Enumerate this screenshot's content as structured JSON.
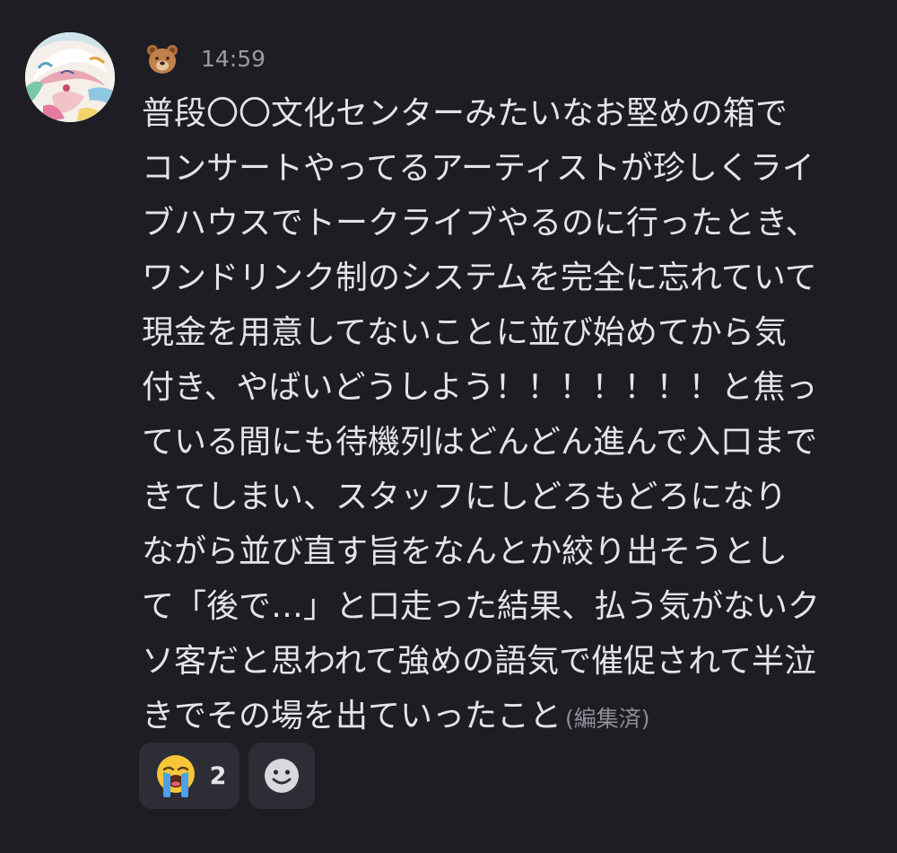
{
  "message": {
    "author_emoji": "bear-face",
    "timestamp": "14:59",
    "lines": [
      "普段〇〇文化センターみたいなお堅めの箱で",
      "コンサートやってるアーティストが珍しくライ",
      "ブハウスでトークライブやるのに行ったとき、",
      "ワンドリンク制のシステムを完全に忘れていて",
      "現金を用意してないことに並び始めてから気",
      "付き、やばいどうしよう！！！！！！！と焦っ",
      "ている間にも待機列はどんどん進んで入口まで",
      "きてしまい、スタッフにしどろもどろになり",
      "ながら並び直す旨をなんとか絞り出そうとし",
      "て「後で…」と口走った結果、払う気がないク",
      "ソ客だと思われて強めの語気で催促されて半泣",
      "きでその場を出ていったこと"
    ],
    "edited_label": "(編集済)"
  },
  "reactions": [
    {
      "emoji": "loudly-crying-face",
      "count": "2"
    }
  ],
  "add_reaction": {
    "icon": "smiley-add-icon"
  },
  "colors": {
    "background": "#1d1d23",
    "text": "#e3e4e8",
    "muted": "#9a9ba3",
    "reaction_bg": "#2c2d35"
  }
}
